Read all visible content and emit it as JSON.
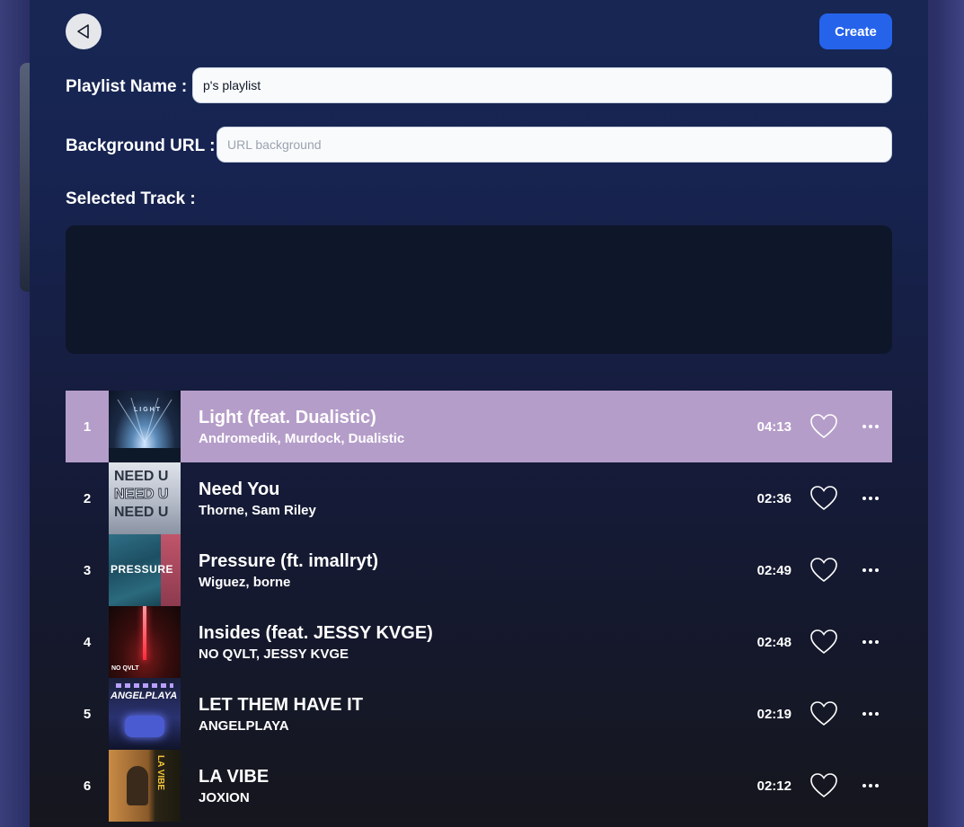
{
  "header": {
    "create_label": "Create"
  },
  "form": {
    "playlist_name_label": "Playlist Name :",
    "playlist_name_value": "p's playlist",
    "background_url_label": "Background URL :",
    "background_url_placeholder": "URL background",
    "selected_track_label": "Selected Track :"
  },
  "tracks": [
    {
      "num": "1",
      "title": "Light (feat. Dualistic)",
      "artists": "Andromedik, Murdock, Dualistic",
      "duration": "04:13",
      "cover_text": "LIGHT"
    },
    {
      "num": "2",
      "title": "Need You",
      "artists": "Thorne, Sam Riley",
      "duration": "02:36",
      "cover_text": "NEED U"
    },
    {
      "num": "3",
      "title": "Pressure (ft. imallryt)",
      "artists": "Wiguez, borne",
      "duration": "02:49",
      "cover_text": "PRESSURE"
    },
    {
      "num": "4",
      "title": "Insides (feat. JESSY KVGE)",
      "artists": "NO QVLT, JESSY KVGE",
      "duration": "02:48",
      "cover_text": "NO QVLT"
    },
    {
      "num": "5",
      "title": "LET THEM HAVE IT",
      "artists": "ANGELPLAYA",
      "duration": "02:19",
      "cover_text": "ANGELPLAYA"
    },
    {
      "num": "6",
      "title": "LA VIBE",
      "artists": "JOXION",
      "duration": "02:12",
      "cover_text": "LA VIBE"
    }
  ],
  "colors": {
    "accent": "#2563eb",
    "active_row": "#b59dc9"
  },
  "icons": {
    "back": "back-arrow-icon",
    "like": "heart-icon",
    "more": "more-horizontal-icon"
  }
}
